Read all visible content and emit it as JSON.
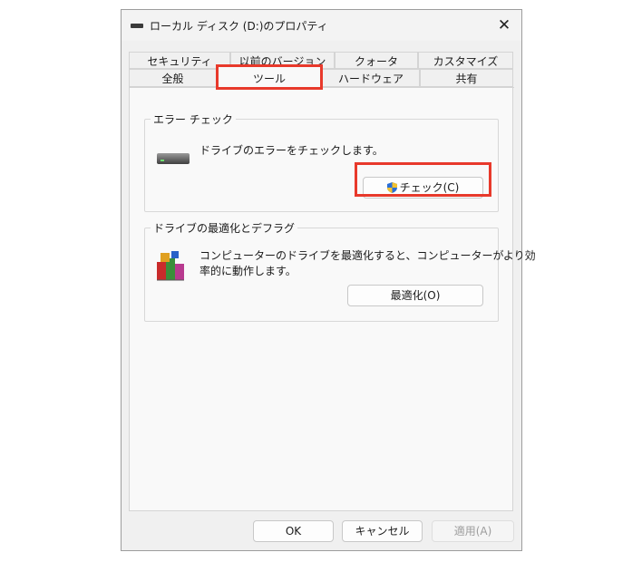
{
  "window": {
    "title": "ローカル ディスク (D:)のプロパティ",
    "close_glyph": "✕"
  },
  "tabs": {
    "back_row": [
      "セキュリティ",
      "以前のバージョン",
      "クォータ",
      "カスタマイズ"
    ],
    "front_row": [
      "全般",
      "ツール",
      "ハードウェア",
      "共有"
    ],
    "active": "ツール"
  },
  "error_check": {
    "group_label": "エラー チェック",
    "description": "ドライブのエラーをチェックします。",
    "button_label": "チェック(C)"
  },
  "optimize": {
    "group_label": "ドライブの最適化とデフラグ",
    "description_line1": "コンピューターのドライブを最適化すると、コンピューターがより効",
    "description_line2": "率的に動作します。",
    "button_label": "最適化(O)"
  },
  "footer": {
    "ok_label": "OK",
    "cancel_label": "キャンセル",
    "apply_label": "適用(A)"
  },
  "colors": {
    "highlight": "#e8392b",
    "window_bg": "#f0f0f0",
    "panel_bg": "#f9f9f9"
  }
}
